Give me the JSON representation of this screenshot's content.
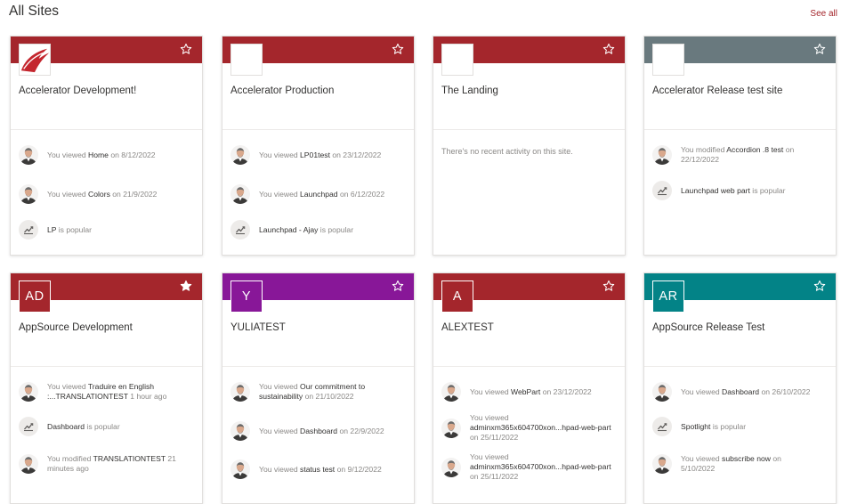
{
  "header": {
    "title": "All Sites",
    "see_all": "See all"
  },
  "colors": {
    "red": "#a4262c",
    "gray": "#69797e",
    "purple": "#881798",
    "teal": "#038387"
  },
  "cards": [
    {
      "title": "Accelerator Development!",
      "favorited": false,
      "activities": [
        {
          "pre": "You viewed ",
          "item": "Home",
          "post": " on 8/12/2022"
        },
        {
          "pre": "You viewed ",
          "item": "Colors",
          "post": " on 21/9/2022"
        },
        {
          "pre": "",
          "item": "LP",
          "post": " is popular"
        }
      ]
    },
    {
      "title": "Accelerator Production",
      "favorited": false,
      "activities": [
        {
          "pre": "You viewed ",
          "item": "LP01test",
          "post": " on 23/12/2022"
        },
        {
          "pre": "You viewed ",
          "item": "Launchpad",
          "post": " on 6/12/2022"
        },
        {
          "pre": "",
          "item": "Launchpad - Ajay",
          "post": " is popular"
        }
      ]
    },
    {
      "title": "The Landing",
      "favorited": false,
      "no_activity": "There's no recent activity on this site."
    },
    {
      "title": "Accelerator Release test site",
      "favorited": false,
      "activities": [
        {
          "pre": "You modified ",
          "item": "Accordion .8 test",
          "post": " on 22/12/2022"
        },
        {
          "pre": "",
          "item": "Launchpad web part",
          "post": " is popular"
        }
      ]
    },
    {
      "title": "AppSource Development",
      "initials": "AD",
      "favorited": true,
      "activities": [
        {
          "pre": "You viewed ",
          "item": "Traduire en English :...TRANSLATIONTEST",
          "post": " 1 hour ago"
        },
        {
          "pre": "",
          "item": "Dashboard",
          "post": " is popular"
        },
        {
          "pre": "You modified ",
          "item": "TRANSLATIONTEST",
          "post": " 21 minutes ago"
        }
      ]
    },
    {
      "title": "YULIATEST",
      "initials": "Y",
      "favorited": false,
      "activities": [
        {
          "pre": "You viewed ",
          "item": "Our commitment to sustainability",
          "post": " on 21/10/2022"
        },
        {
          "pre": "You viewed ",
          "item": "Dashboard",
          "post": " on 22/9/2022"
        },
        {
          "pre": "You viewed ",
          "item": "status test",
          "post": " on 9/12/2022"
        }
      ]
    },
    {
      "title": "ALEXTEST",
      "initials": "A",
      "favorited": false,
      "activities": [
        {
          "pre": "You viewed ",
          "item": "WebPart",
          "post": " on 23/12/2022"
        },
        {
          "pre": "You viewed ",
          "item": "adminxm365x604700xon...hpad-web-part",
          "post": " on 25/11/2022"
        },
        {
          "pre": "You viewed ",
          "item": "adminxm365x604700xon...hpad-web-part",
          "post": " on 25/11/2022"
        }
      ]
    },
    {
      "title": "AppSource Release Test",
      "initials": "AR",
      "favorited": false,
      "activities": [
        {
          "pre": "You viewed ",
          "item": "Dashboard",
          "post": " on 26/10/2022"
        },
        {
          "pre": "",
          "item": "Spotlight",
          "post": " is popular"
        },
        {
          "pre": "You viewed ",
          "item": "subscribe now",
          "post": " on 5/10/2022"
        }
      ]
    }
  ]
}
